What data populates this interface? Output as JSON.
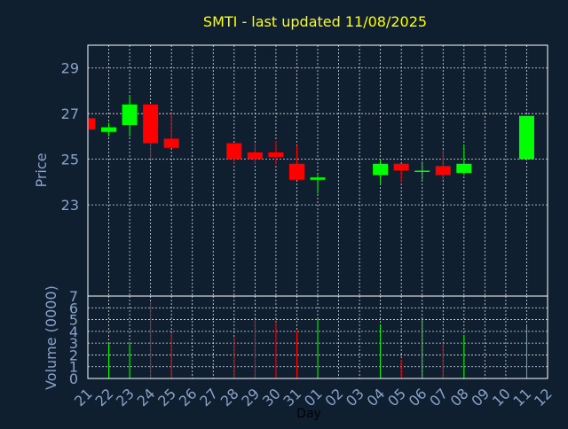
{
  "chart_data": {
    "type": "candlestick",
    "title": "SMTI - last updated 11/08/2025",
    "xlabel": "Day",
    "ylabel_price": "Price",
    "ylabel_volume": "Volume (0000)",
    "x_ticks": [
      "21",
      "22",
      "23",
      "24",
      "25",
      "26",
      "27",
      "28",
      "29",
      "30",
      "31",
      "01",
      "02",
      "03",
      "04",
      "05",
      "06",
      "07",
      "08",
      "09",
      "10",
      "11",
      "12"
    ],
    "price_ticks": [
      23,
      25,
      27,
      29
    ],
    "price_ylim": [
      19.0,
      30.0
    ],
    "volume_ticks": [
      0,
      1,
      2,
      3,
      4,
      5,
      6,
      7
    ],
    "volume_ylim": [
      0,
      7
    ],
    "up_color": "#00ff00",
    "down_color": "#ff0000",
    "candles": [
      {
        "day": "21",
        "open": 26.8,
        "high": 26.8,
        "low": 26.3,
        "close": 26.3,
        "volume": 0.0
      },
      {
        "day": "22",
        "open": 26.2,
        "high": 26.6,
        "low": 26.0,
        "close": 26.4,
        "volume": 3.0
      },
      {
        "day": "23",
        "open": 26.5,
        "high": 27.8,
        "low": 26.0,
        "close": 27.4,
        "volume": 3.0
      },
      {
        "day": "24",
        "open": 27.4,
        "high": 27.4,
        "low": 25.0,
        "close": 25.7,
        "volume": 6.5
      },
      {
        "day": "25",
        "open": 25.9,
        "high": 27.0,
        "low": 25.5,
        "close": 25.5,
        "volume": 3.8
      },
      {
        "day": "28",
        "open": 25.7,
        "high": 25.7,
        "low": 24.8,
        "close": 25.0,
        "volume": 3.5
      },
      {
        "day": "29",
        "open": 25.3,
        "high": 25.7,
        "low": 24.8,
        "close": 25.0,
        "volume": 5.0
      },
      {
        "day": "30",
        "open": 25.3,
        "high": 25.8,
        "low": 24.8,
        "close": 25.1,
        "volume": 4.8
      },
      {
        "day": "31",
        "open": 24.8,
        "high": 25.6,
        "low": 24.1,
        "close": 24.1,
        "volume": 4.0
      },
      {
        "day": "01",
        "open": 24.1,
        "high": 24.3,
        "low": 23.5,
        "close": 24.2,
        "volume": 5.1
      },
      {
        "day": "04",
        "open": 24.3,
        "high": 25.0,
        "low": 23.9,
        "close": 24.8,
        "volume": 4.6
      },
      {
        "day": "05",
        "open": 24.8,
        "high": 24.8,
        "low": 24.0,
        "close": 24.5,
        "volume": 1.6
      },
      {
        "day": "06",
        "open": 24.5,
        "high": 24.9,
        "low": 24.1,
        "close": 24.5,
        "volume": 5.0
      },
      {
        "day": "07",
        "open": 24.7,
        "high": 25.4,
        "low": 24.1,
        "close": 24.3,
        "volume": 3.0
      },
      {
        "day": "08",
        "open": 24.4,
        "high": 25.6,
        "low": 24.3,
        "close": 24.8,
        "volume": 3.7
      },
      {
        "day": "11",
        "open": 25.0,
        "high": 26.9,
        "low": 25.0,
        "close": 26.9,
        "volume": 4.6
      }
    ]
  }
}
